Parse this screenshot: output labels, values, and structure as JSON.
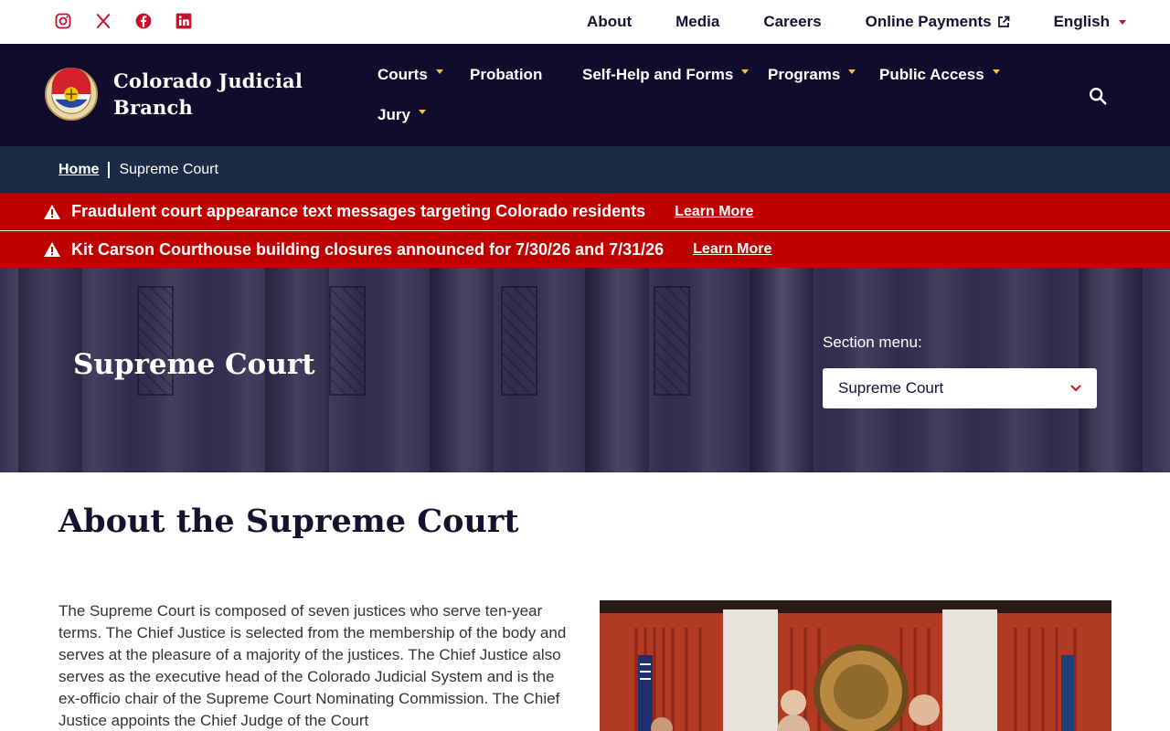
{
  "utility": {
    "social": [
      "instagram-icon",
      "x-icon",
      "facebook-icon",
      "linkedin-icon"
    ],
    "links": {
      "about": "About",
      "media": "Media",
      "careers": "Careers",
      "payments": "Online Payments",
      "language": "English"
    }
  },
  "header": {
    "brand_line1": "Colorado Judicial",
    "brand_line2": "Branch",
    "nav": {
      "courts": "Courts",
      "probation": "Probation",
      "selfhelp": "Self-Help and Forms",
      "programs": "Programs",
      "public_access": "Public Access",
      "jury": "Jury"
    }
  },
  "breadcrumb": {
    "home": "Home",
    "current": "Supreme Court"
  },
  "alerts": [
    {
      "message": "Fraudulent court appearance text messages targeting Colorado residents",
      "link": "Learn More"
    },
    {
      "message": "Kit Carson Courthouse building closures announced for 7/30/26 and 7/31/26",
      "link": "Learn More"
    }
  ],
  "hero": {
    "title": "Supreme Court",
    "section_menu_label": "Section menu:",
    "section_menu_value": "Supreme Court"
  },
  "content": {
    "heading": "About the Supreme Court",
    "paragraph": "The Supreme Court is composed of seven justices who serve ten-year terms. The Chief Justice is selected from the membership of the body and serves at the pleasure of a majority of the justices. The Chief Justice also serves as the executive head of the Colorado Judicial System and is the ex-officio chair of the Supreme Court Nominating Commission. The Chief Justice appoints the Chief Judge of the Court"
  },
  "colors": {
    "navy": "#0f0c2d",
    "breadcrumb_bg": "#1b2b45",
    "alert_red": "#bf0000",
    "accent_gold": "#f6c243",
    "social_red": "#c8102e"
  }
}
